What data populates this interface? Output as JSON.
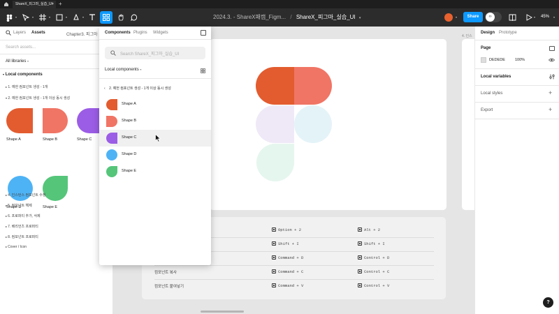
{
  "browser": {
    "tab_title": "ShareX_피그마_실습_UI",
    "tab_close": "×",
    "new_tab": "+"
  },
  "toolbar": {
    "doc_prefix": "2024.3. - ShareX패캠_Figm...",
    "separator": "/",
    "file_name": "ShareX_피그마_실습_UI",
    "share_label": "Share",
    "zoom_label": "45%",
    "avatar_color": "#e8622f",
    "accent": "#0d99ff"
  },
  "left_panel": {
    "tab_layers": "Layers",
    "tab_assets": "Assets",
    "page_crumb": "Chapter3. 피그마",
    "search_placeholder": "Search assets...",
    "libraries_label": "All libraries",
    "section_title": "Local components",
    "groups": [
      {
        "label": "1. 예헌 컴포넌트 생성 - 1개"
      },
      {
        "label": "2. 예헌 컴포넌트 생성 - 1개 이상 동시 생성"
      }
    ],
    "shapes": [
      {
        "label": "Shape A",
        "color": "#e25c2f"
      },
      {
        "label": "Shape B",
        "color": "#f07565"
      },
      {
        "label": "Shape C",
        "color": "#9b5de5"
      },
      {
        "label": "Shape D",
        "color": "#4eb3f5"
      },
      {
        "label": "Shape E",
        "color": "#55c57a"
      }
    ],
    "more_groups": [
      {
        "label": "4. 인스턴스 컴포넌트 수정"
      },
      {
        "label": "5. 컴포넌트 해제"
      },
      {
        "label": "6. 프로퍼티 추가, 삭제"
      },
      {
        "label": "7. 베리언츠 프로퍼티"
      },
      {
        "label": "8. 컴포넌트 프로퍼티"
      },
      {
        "label": "Cover / Icon"
      }
    ]
  },
  "popup": {
    "tabs": [
      "Components",
      "Plugins",
      "Widgets"
    ],
    "search_placeholder": "Search ShareX_피그마_실습_UI",
    "local_label": "Local components",
    "back_label": "2. 예헌 컴포넌트 생성 - 1개 이상 동시 생성",
    "items": [
      {
        "label": "Shape A",
        "color": "#e25c2f"
      },
      {
        "label": "Shape B",
        "color": "#f07565"
      },
      {
        "label": "Shape C",
        "color": "#9b5de5"
      },
      {
        "label": "Shape D",
        "color": "#4eb3f5"
      },
      {
        "label": "Shape E",
        "color": "#55c57a"
      }
    ]
  },
  "canvas": {
    "frame_label_right": "4. 인스",
    "shortcuts": [
      {
        "label": "",
        "mac": "Option + 2",
        "win": "Alt + 2"
      },
      {
        "label": "",
        "mac": "Shift + I",
        "win": "Shift + I"
      },
      {
        "label": "",
        "mac": "Command + D",
        "win": "Control + D"
      },
      {
        "label": "컴포넌트 복사",
        "mac": "Command + C",
        "win": "Control + C"
      },
      {
        "label": "컴포넌트 붙여넣기",
        "mac": "Command + V",
        "win": "Control + V"
      }
    ],
    "logo_colors": [
      "#e25c2f",
      "#f07565",
      "#efe9f7",
      "#e4f3f8",
      "#e5f6ee"
    ]
  },
  "right_panel": {
    "tab_design": "Design",
    "tab_prototype": "Prototype",
    "page_title": "Page",
    "page_color_hex": "DEDEDE",
    "page_opacity": "100%",
    "page_swatch": "#dedede",
    "local_variables": "Local variables",
    "local_styles": "Local styles",
    "export": "Export",
    "plus": "+",
    "help": "?"
  }
}
